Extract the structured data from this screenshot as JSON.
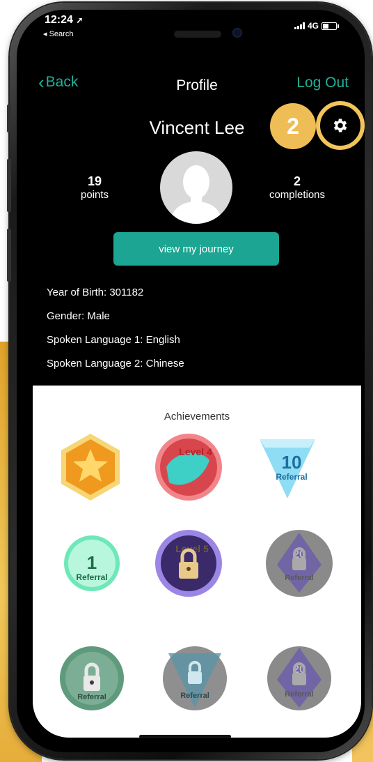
{
  "status": {
    "time": "12:24",
    "back_app": "◂ Search",
    "network": "4G"
  },
  "nav": {
    "back_label": "Back",
    "title": "Profile",
    "logout_label": "Log Out"
  },
  "profile": {
    "name": "Vincent Lee",
    "points_value": "19",
    "points_label": "points",
    "completions_value": "2",
    "completions_label": "completions",
    "journey_button": "view my journey",
    "year_of_birth": "Year of Birth: 301182",
    "gender": "Gender: Male",
    "language_1": "Spoken Language 1: English",
    "language_2": "Spoken Language 2: Chinese"
  },
  "callout": {
    "number": "2"
  },
  "achievements": {
    "title": "Achievements",
    "badges": [
      {
        "label": "",
        "kind": "star-hexagon",
        "locked": false
      },
      {
        "label": "Level 4",
        "kind": "leaf-level",
        "locked": false
      },
      {
        "label": "10",
        "sub": "Referral",
        "kind": "triangle-referral",
        "locked": false
      },
      {
        "label": "1",
        "sub": "Referral",
        "kind": "bubble-referral",
        "locked": false
      },
      {
        "label": "Level 5",
        "kind": "level",
        "locked": true
      },
      {
        "label": "20",
        "sub": "Referral",
        "kind": "pyramid-referral",
        "locked": true
      },
      {
        "label": "",
        "sub": "Referral",
        "kind": "bubble-referral",
        "locked": true
      },
      {
        "label": "",
        "sub": "Referral",
        "kind": "triangle-referral",
        "locked": true
      },
      {
        "label": "20",
        "sub": "Referral",
        "kind": "pyramid-referral",
        "locked": true
      }
    ]
  },
  "colors": {
    "accent": "#1fb199",
    "callout": "#efbd55",
    "button": "#1ba592"
  }
}
